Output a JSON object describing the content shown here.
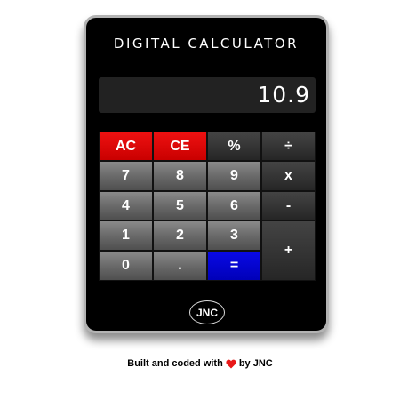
{
  "calculator": {
    "title": "DIGITAL CALCULATOR",
    "display_value": "10.9",
    "keys": [
      {
        "label": "AC",
        "name": "all-clear-button",
        "style": "red"
      },
      {
        "label": "CE",
        "name": "clear-entry-button",
        "style": "red"
      },
      {
        "label": "%",
        "name": "percent-button",
        "style": "dark"
      },
      {
        "label": "÷",
        "name": "divide-button",
        "style": "dark"
      },
      {
        "label": "7",
        "name": "digit-7-button",
        "style": "grey"
      },
      {
        "label": "8",
        "name": "digit-8-button",
        "style": "grey"
      },
      {
        "label": "9",
        "name": "digit-9-button",
        "style": "grey"
      },
      {
        "label": "x",
        "name": "multiply-button",
        "style": "dark"
      },
      {
        "label": "4",
        "name": "digit-4-button",
        "style": "grey"
      },
      {
        "label": "5",
        "name": "digit-5-button",
        "style": "grey"
      },
      {
        "label": "6",
        "name": "digit-6-button",
        "style": "grey"
      },
      {
        "label": "-",
        "name": "subtract-button",
        "style": "dark"
      },
      {
        "label": "1",
        "name": "digit-1-button",
        "style": "grey"
      },
      {
        "label": "2",
        "name": "digit-2-button",
        "style": "grey"
      },
      {
        "label": "3",
        "name": "digit-3-button",
        "style": "grey"
      },
      {
        "label": "+",
        "name": "add-button",
        "style": "dark"
      },
      {
        "label": "0",
        "name": "digit-0-button",
        "style": "grey"
      },
      {
        "label": ".",
        "name": "decimal-button",
        "style": "grey"
      },
      {
        "label": "=",
        "name": "equals-button",
        "style": "blue"
      }
    ],
    "badge": "JNC"
  },
  "footer": {
    "prefix": "Built and coded with",
    "icon": "heart-icon",
    "suffix": "by JNC"
  },
  "colors": {
    "red_key": "#e00000",
    "equals_key": "#0000d6",
    "heart": "#e81818"
  }
}
